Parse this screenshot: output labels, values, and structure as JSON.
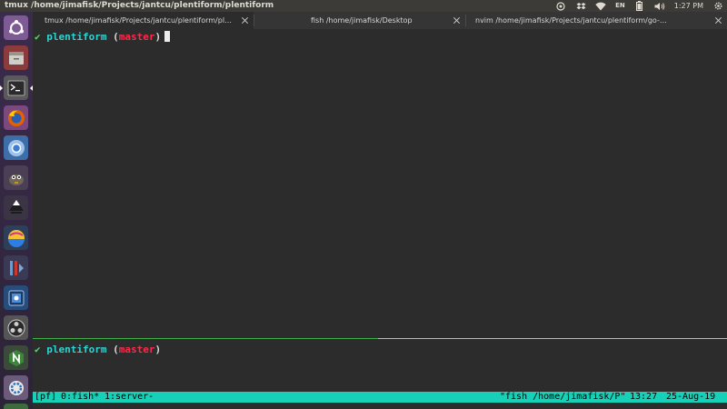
{
  "top_panel": {
    "window_title": "tmux /home/jimafisk/Projects/jantcu/plentiform/plentiform",
    "keyboard_layout": "EN",
    "clock": "1:27 PM",
    "icons": [
      "chat-icon",
      "dropbox-icon",
      "wifi-icon",
      "keyboard-layout-indicator",
      "battery-icon",
      "volume-icon",
      "clock",
      "gear-icon"
    ]
  },
  "launcher": {
    "icons": [
      "ubuntu-dash-icon",
      "files-icon",
      "terminal-icon",
      "firefox-icon",
      "chromium-icon",
      "gimp-icon",
      "inkscape-icon",
      "krita-icon",
      "kdenlive-icon",
      "virtualbox-icon",
      "obs-icon",
      "nodejs-icon",
      "settings-icon",
      "app-icon"
    ]
  },
  "tabs": [
    {
      "label": "tmux /home/jimafisk/Projects/jantcu/plentiform/pl…",
      "active": true
    },
    {
      "label": "fish /home/jimafisk/Desktop",
      "active": false
    },
    {
      "label": "nvim /home/jimafisk/Projects/jantcu/plentiform/go-…",
      "active": false
    }
  ],
  "terminal": {
    "top_pane": {
      "check": "✔",
      "dir": "plentiform",
      "open": "(",
      "branch": "master",
      "close": ")"
    },
    "bottom_pane": {
      "check": "✔",
      "dir": "plentiform",
      "open": "(",
      "branch": "master",
      "close": ")"
    }
  },
  "tmux_status": {
    "session": "[pf]",
    "window0": "0:fish*",
    "window1": "1:server-",
    "right_title": "\"fish /home/jimafisk/P\"",
    "time": "13:27",
    "date": "25-Aug-19"
  },
  "colors": {
    "status_bar": "#16d0b8",
    "prompt_check": "#4cd964",
    "prompt_dir": "#33d1d1",
    "prompt_branch": "#ff2a4a",
    "active_pane_border": "#3fb04a"
  }
}
